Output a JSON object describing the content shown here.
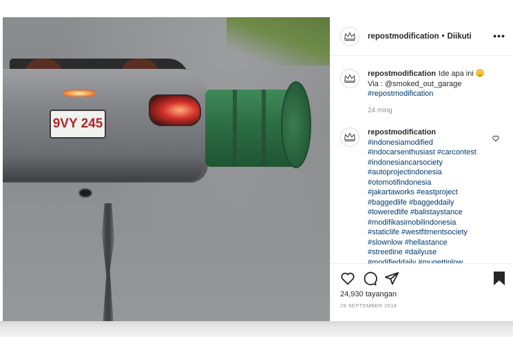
{
  "media": {
    "license_plate": "9VY 245"
  },
  "post_header": {
    "username": "repostmodification",
    "separator": "•",
    "follow_status": "Diikuti",
    "more_label": "•••"
  },
  "caption": {
    "username": "repostmodification",
    "text": "Ide apa ini",
    "via_line": "Via : @smoked_out_garage",
    "hashtag": "#repostmodification",
    "time": "24 ming"
  },
  "comment": {
    "username": "repostmodification",
    "hashtags": [
      "#indonesiamodified",
      "#indocarsenthusiast #carcontest",
      "#indonesiancarsociety",
      "#autoprojectindonesia",
      "#otomotifindonesia",
      "#jakartaworks #eastproject",
      "#baggedlife #baggeddaily",
      "#loweredlife #balistaystance",
      "#modifikasimobilindonesia",
      "#staticlife #westfitmentsociety",
      "#slownlow #hellastance",
      "#streetline #dailyuse",
      "#modifieddaily #mugettinlow"
    ]
  },
  "actions": {
    "views": "24,930 tayangan",
    "date": "29 SEPTEMBER 2019"
  },
  "icons": {
    "like": "heart-icon",
    "comment": "comment-icon",
    "share": "paper-plane-icon",
    "save": "bookmark-icon",
    "more": "ellipsis-icon",
    "avatar": "crown-logo-icon"
  },
  "colors": {
    "link": "#00376b",
    "muted": "#8e8e8e",
    "text": "#262626"
  }
}
